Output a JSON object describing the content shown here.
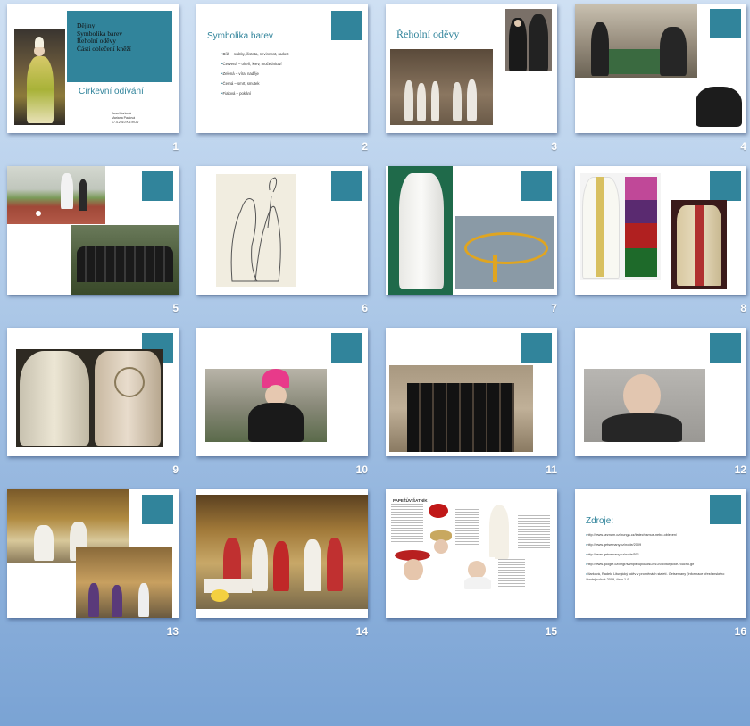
{
  "slides": [
    {
      "number": "1",
      "title_lines": [
        "Dějiny",
        "Symbolika barev",
        "Řeholní oděvy",
        "Části oblečení kněží"
      ],
      "subtitle": "Církevní odívání",
      "author_lines": [
        "Jana Marková",
        "Mariana Pavlová",
        "17.4.2010 KATKOV"
      ]
    },
    {
      "number": "2",
      "title": "Symbolika barev",
      "bullets": [
        "Bílá – svátky, čistota, nevinnost, radost",
        "Červená – oheň, krev, mučednictví",
        "Zelená – víra, naděje",
        "Černá – smrt, smutek",
        "Fialová – pokání"
      ]
    },
    {
      "number": "3",
      "title": "Řeholní oděvy"
    },
    {
      "number": "4"
    },
    {
      "number": "5"
    },
    {
      "number": "6"
    },
    {
      "number": "7"
    },
    {
      "number": "8"
    },
    {
      "number": "9"
    },
    {
      "number": "10"
    },
    {
      "number": "11"
    },
    {
      "number": "12"
    },
    {
      "number": "13"
    },
    {
      "number": "14"
    },
    {
      "number": "15",
      "header": "PAPEŽŮV ŠATNÍK"
    },
    {
      "number": "16",
      "title": "Zdroje:",
      "sources": [
        "http://www.seznam.cz/bunga.cz/katechismus-nebo-oblecen/",
        "http://www.getsemany.cz/node/2009",
        "http://www.getsemany.cz/node/501",
        "http://www.google.cz/imgr/sample/uploads/2010/03/liturgicke-roucho.gif",
        "Marková, Radek. Liturgický oděv v proměnách staletí. Getsemany (Informace křesťanského života) ročník 2009, číslo 1-9"
      ]
    }
  ],
  "colors": {
    "accent": "#31849b",
    "background_top": "#cfe0f3",
    "background_bottom": "#7aa3d4"
  }
}
